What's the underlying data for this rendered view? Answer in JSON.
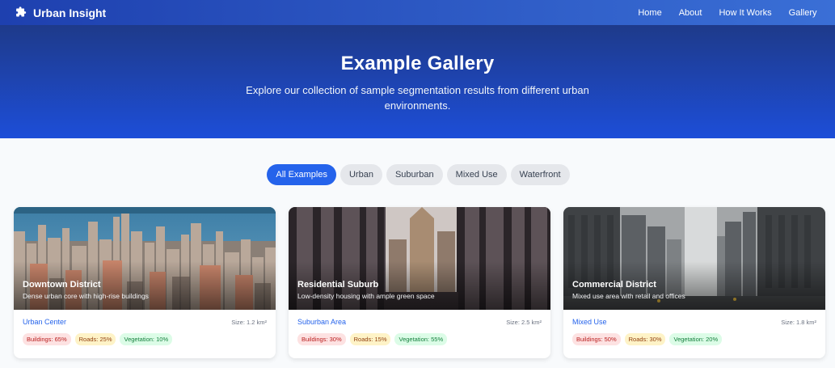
{
  "nav": {
    "brand": "Urban Insight",
    "brand_icon": "puzzle-icon",
    "links": [
      "Home",
      "About",
      "How It Works",
      "Gallery"
    ]
  },
  "hero": {
    "title": "Example Gallery",
    "subtitle": "Explore our collection of sample segmentation results from different urban environments."
  },
  "filters": {
    "active": "All Examples",
    "items": [
      "All Examples",
      "Urban",
      "Suburban",
      "Mixed Use",
      "Waterfront"
    ]
  },
  "cards": [
    {
      "title": "Downtown District",
      "description": "Dense urban core with high-rise buildings",
      "category": "Urban Center",
      "size": "Size: 1.2 km²",
      "tags": {
        "buildings": "Buildings: 65%",
        "roads": "Roads: 25%",
        "vegetation": "Vegetation: 10%"
      }
    },
    {
      "title": "Residential Suburb",
      "description": "Low-density housing with ample green space",
      "category": "Suburban Area",
      "size": "Size: 2.5 km²",
      "tags": {
        "buildings": "Buildings: 30%",
        "roads": "Roads: 15%",
        "vegetation": "Vegetation: 55%"
      }
    },
    {
      "title": "Commercial District",
      "description": "Mixed use area with retail and offices",
      "category": "Mixed Use",
      "size": "Size: 1.8 km²",
      "tags": {
        "buildings": "Buildings: 50%",
        "roads": "Roads: 30%",
        "vegetation": "Vegetation: 20%"
      }
    }
  ],
  "colors": {
    "accent": "#2563eb",
    "hero_top": "#1e3a8a",
    "hero_bottom": "#1d4ed8"
  }
}
